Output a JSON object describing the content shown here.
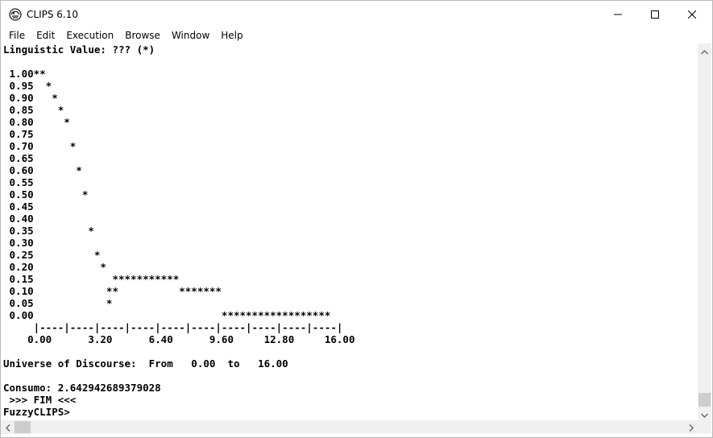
{
  "window": {
    "title": "CLIPS 6.10",
    "icon": "clips-app-icon",
    "controls": [
      "minimize-icon",
      "maximize-icon",
      "close-icon"
    ]
  },
  "menubar": {
    "items": [
      "File",
      "Edit",
      "Execution",
      "Browse",
      "Window",
      "Help"
    ]
  },
  "console": {
    "lines": [
      "Linguistic Value: ??? (*)",
      "",
      " 1.00**",
      " 0.95  *",
      " 0.90   *",
      " 0.85    *",
      " 0.80     *",
      " 0.75",
      " 0.70      *",
      " 0.65",
      " 0.60       *",
      " 0.55",
      " 0.50        *",
      " 0.45",
      " 0.40",
      " 0.35         *",
      " 0.30",
      " 0.25          *",
      " 0.20           *",
      " 0.15             ***********",
      " 0.10            **          *******",
      " 0.05            *",
      " 0.00                               ******************",
      "     |----|----|----|----|----|----|----|----|----|----|",
      "    0.00      3.20      6.40      9.60     12.80     16.00",
      "",
      "Universe of Discourse:  From   0.00  to   16.00",
      "",
      "Consumo: 2.642942689379028",
      " >>> FIM <<<",
      "FuzzyCLIPS>"
    ]
  },
  "scrollbars": {
    "vertical": {
      "position_fraction": 0.98
    },
    "horizontal": {
      "position_fraction": 0.0
    }
  }
}
